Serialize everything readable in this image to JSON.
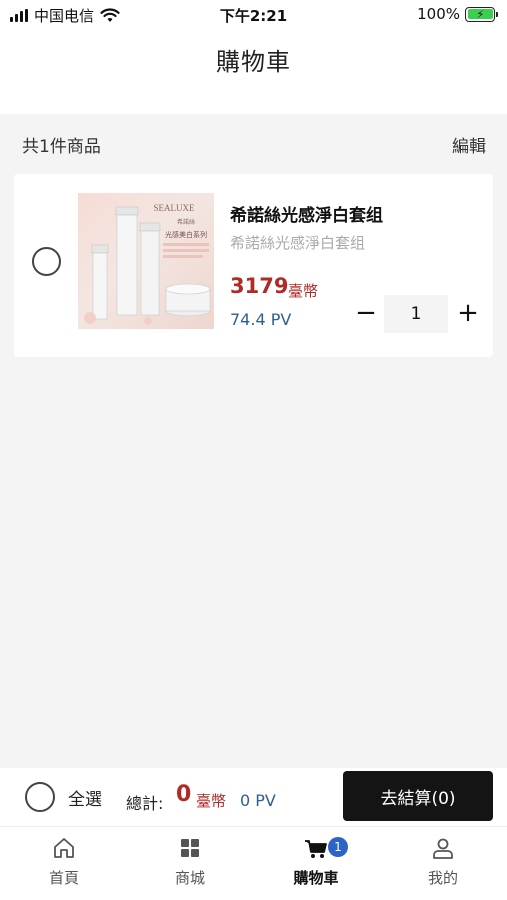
{
  "status_bar": {
    "carrier": "中国电信",
    "time": "下午2:21",
    "battery": "100%"
  },
  "header": {
    "title": "購物車"
  },
  "cart": {
    "count_text": "共1件商品",
    "edit_label": "編輯",
    "items": [
      {
        "name": "希諾絲光感淨白套组",
        "subtitle": "希諾絲光感淨白套组",
        "price": "3179",
        "currency": "臺幣",
        "pv": "74.4 PV",
        "quantity": "1",
        "minus_label": "−",
        "plus_label": "+",
        "image_brand": "SEALUXE",
        "image_brand_cn": "希諾絲",
        "image_series": "光感美白系列"
      }
    ]
  },
  "checkout": {
    "select_all_label": "全選",
    "total_label": "總計:",
    "total_amount": "0",
    "total_currency": "臺幣",
    "total_pv": "0 PV",
    "button_label": "去結算(0)"
  },
  "tabs": [
    {
      "label": "首頁",
      "icon": "home-icon"
    },
    {
      "label": "商城",
      "icon": "grid-icon"
    },
    {
      "label": "購物車",
      "icon": "cart-icon",
      "badge": "1",
      "active": true
    },
    {
      "label": "我的",
      "icon": "user-icon"
    }
  ],
  "colors": {
    "price_red": "#b02a26",
    "pv_blue": "#2f5f8f",
    "badge_blue": "#2d62c7",
    "button_dark": "#141414"
  }
}
